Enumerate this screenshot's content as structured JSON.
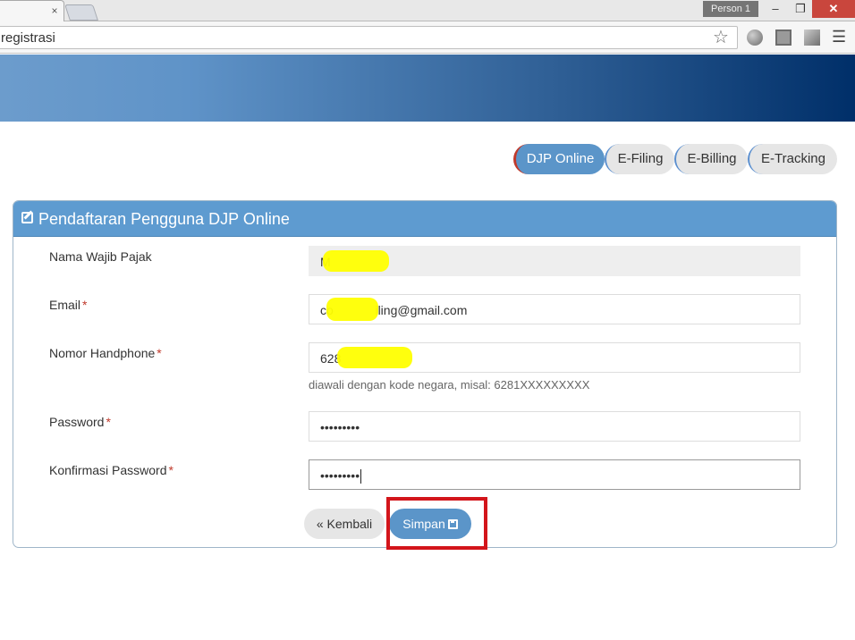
{
  "browser": {
    "tab_close_glyph": "×",
    "profile_name": "Person 1",
    "address_text": "registrasi"
  },
  "nav": {
    "tabs": [
      {
        "label": "DJP Online"
      },
      {
        "label": "E-Filing"
      },
      {
        "label": "E-Billing"
      },
      {
        "label": "E-Tracking"
      }
    ]
  },
  "form": {
    "title": "Pendaftaran Pengguna DJP Online",
    "required_mark": "*",
    "fields": {
      "nama": {
        "label": "Nama Wajib Pajak",
        "value": "M"
      },
      "email": {
        "label": "Email",
        "value": "co            iling@gmail.com"
      },
      "phone": {
        "label": "Nomor Handphone",
        "value": "628",
        "hint": "diawali dengan kode negara, misal: 6281XXXXXXXXX"
      },
      "password": {
        "label": "Password",
        "value": "•••••••••"
      },
      "confirm": {
        "label": "Konfirmasi Password",
        "value": "•••••••••"
      }
    },
    "buttons": {
      "back": "« Kembali",
      "save": "Simpan"
    }
  },
  "colors": {
    "primary": "#5b95c9",
    "highlight": "#d3151b",
    "redaction": "#ffff00"
  }
}
